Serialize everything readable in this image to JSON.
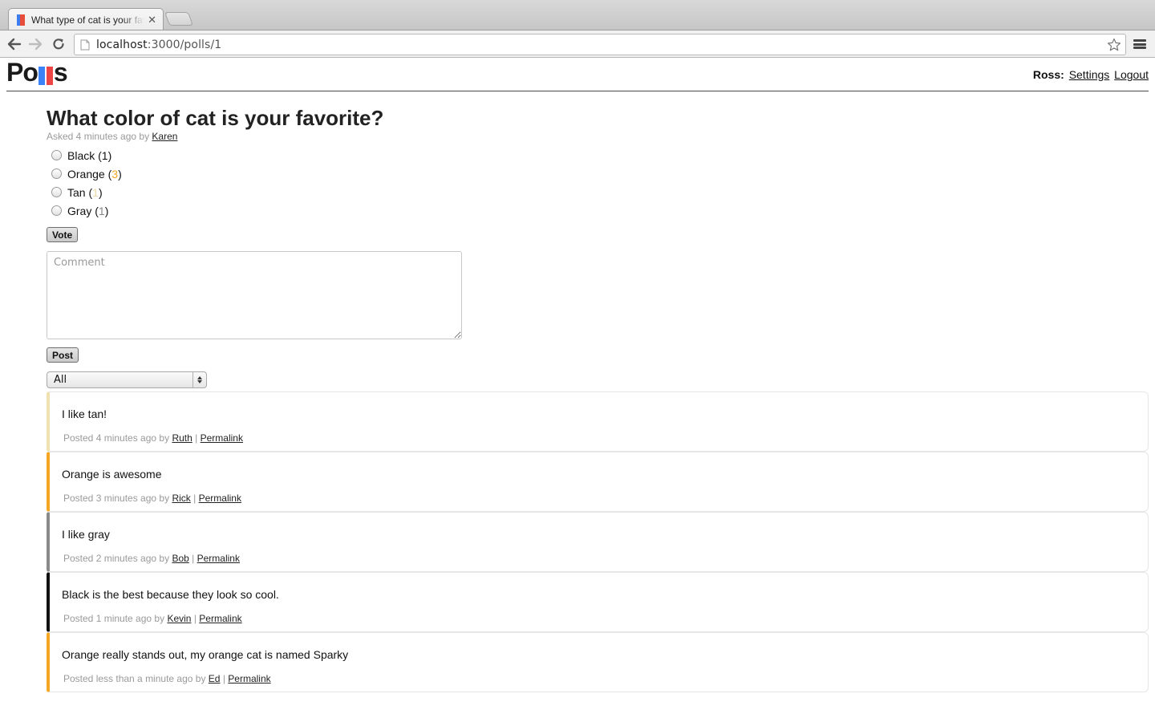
{
  "browser": {
    "tab_title": "What type of cat is your favorite?",
    "url_host": "localhost",
    "url_rest": ":3000/polls/1"
  },
  "header": {
    "logo_left": "Po",
    "logo_right": "s",
    "user_label": "Ross:",
    "settings_link": "Settings",
    "logout_link": "Logout"
  },
  "poll": {
    "title": "What color of cat is your favorite?",
    "asked_prefix": "Asked 4 minutes ago by",
    "author": "Karen",
    "options": [
      {
        "label": "Black",
        "count": "1",
        "color": "#111111"
      },
      {
        "label": "Orange",
        "count": "3",
        "color": "#f5a623"
      },
      {
        "label": "Tan",
        "count": "1",
        "color": "#e8d9a8"
      },
      {
        "label": "Gray",
        "count": "1",
        "color": "#888888"
      }
    ],
    "vote_label": "Vote"
  },
  "comment_form": {
    "placeholder": "Comment",
    "post_label": "Post",
    "filter_value": "All"
  },
  "comments": [
    {
      "text": "I like tan!",
      "posted": "Posted 4 minutes ago by",
      "author": "Ruth",
      "permalink": "Permalink",
      "color": "#f0e2b0"
    },
    {
      "text": "Orange is awesome",
      "posted": "Posted 3 minutes ago by",
      "author": "Rick",
      "permalink": "Permalink",
      "color": "#f5a623"
    },
    {
      "text": "I like gray",
      "posted": "Posted 2 minutes ago by",
      "author": "Bob",
      "permalink": "Permalink",
      "color": "#8a8a8a"
    },
    {
      "text": "Black is the best because they look so cool.",
      "posted": "Posted 1 minute ago by",
      "author": "Kevin",
      "permalink": "Permalink",
      "color": "#111111"
    },
    {
      "text": "Orange really stands out, my orange cat is named Sparky",
      "posted": "Posted less than a minute ago by",
      "author": "Ed",
      "permalink": "Permalink",
      "color": "#f5a623"
    }
  ]
}
